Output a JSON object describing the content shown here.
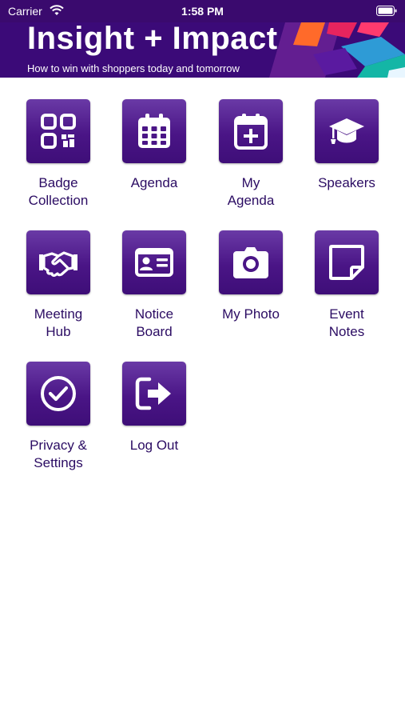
{
  "status_bar": {
    "carrier": "Carrier",
    "time": "1:58 PM"
  },
  "banner": {
    "title": "Insight + Impact",
    "subtitle": "How to win with shoppers today and tomorrow"
  },
  "menu": [
    {
      "label": "Badge\nCollection",
      "icon": "qr-code-icon"
    },
    {
      "label": "Agenda",
      "icon": "calendar-icon"
    },
    {
      "label": "My\nAgenda",
      "icon": "calendar-add-icon"
    },
    {
      "label": "Speakers",
      "icon": "graduation-cap-icon"
    },
    {
      "label": "Meeting\nHub",
      "icon": "handshake-icon"
    },
    {
      "label": "Notice\nBoard",
      "icon": "id-card-icon"
    },
    {
      "label": "My Photo",
      "icon": "camera-icon"
    },
    {
      "label": "Event\nNotes",
      "icon": "sticky-note-icon"
    },
    {
      "label": "Privacy &\nSettings",
      "icon": "check-circle-icon"
    },
    {
      "label": "Log Out",
      "icon": "logout-icon"
    }
  ],
  "colors": {
    "brand": "#3b0a78",
    "tile": "#4a1586",
    "label": "#2b0c63"
  }
}
